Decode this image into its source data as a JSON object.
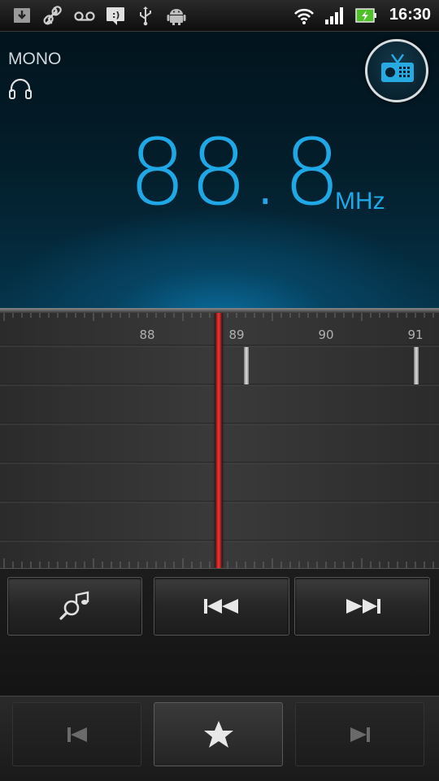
{
  "status_bar": {
    "time": "16:30",
    "left_icons": [
      "download-icon",
      "link-icon",
      "voicemail-icon",
      "messaging-icon",
      "usb-icon",
      "android-icon"
    ],
    "right_icons": [
      "wifi-icon",
      "signal-icon",
      "battery-charging-icon"
    ]
  },
  "display": {
    "mode": "MONO",
    "frequency": "88.8",
    "unit": "MHz",
    "accent_color": "#1ea9e6"
  },
  "tuner": {
    "tick_labels": [
      "88",
      "89",
      "90",
      "91"
    ],
    "needle_color": "#e23030"
  },
  "controls": {
    "buttons": [
      "track-identify-icon",
      "seek-back-icon",
      "seek-forward-icon"
    ]
  },
  "bottom_bar": {
    "buttons": [
      "previous-favorite-icon",
      "favorite-star-icon",
      "next-favorite-icon"
    ]
  }
}
